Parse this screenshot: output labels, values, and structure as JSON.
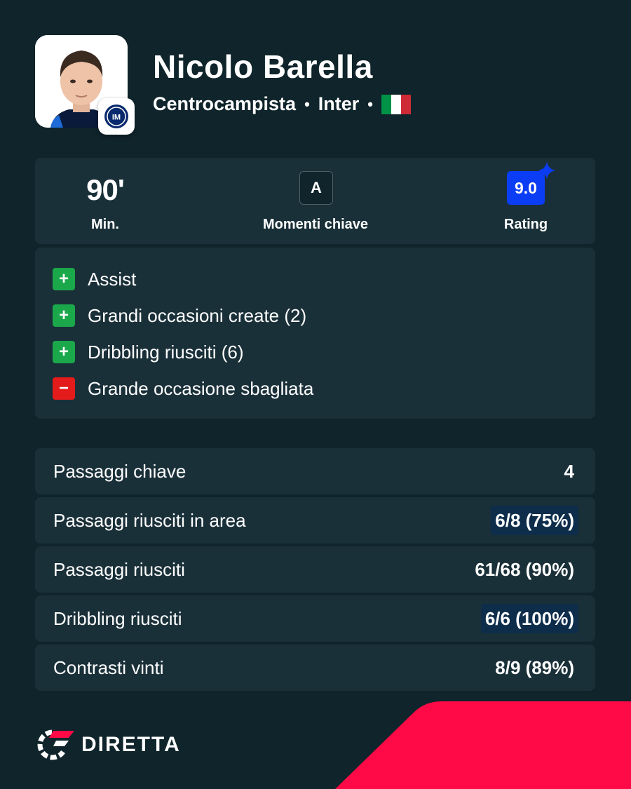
{
  "player": {
    "name": "Nicolo Barella",
    "position": "Centrocampista",
    "team": "Inter",
    "separator": "•",
    "flag_colors": [
      "#009246",
      "#ffffff",
      "#ce2b37"
    ]
  },
  "summary": {
    "minutes_value": "90'",
    "minutes_label": "Min.",
    "key_moments_icon_letter": "A",
    "key_moments_label": "Momenti chiave",
    "rating_value": "9.0",
    "rating_label": "Rating"
  },
  "events": [
    {
      "type": "plus",
      "sign": "+",
      "text": "Assist"
    },
    {
      "type": "plus",
      "sign": "+",
      "text": "Grandi occasioni create (2)"
    },
    {
      "type": "plus",
      "sign": "+",
      "text": "Dribbling riusciti (6)"
    },
    {
      "type": "minus",
      "sign": "−",
      "text": "Grande occasione sbagliata"
    }
  ],
  "stats": [
    {
      "label": "Passaggi chiave",
      "value": "4",
      "highlighted": false
    },
    {
      "label": "Passaggi riusciti in area",
      "value": "6/8 (75%)",
      "highlighted": true
    },
    {
      "label": "Passaggi riusciti",
      "value": "61/68 (90%)",
      "highlighted": false
    },
    {
      "label": "Dribbling riusciti",
      "value": "6/6 (100%)",
      "highlighted": true
    },
    {
      "label": "Contrasti vinti",
      "value": "8/9 (89%)",
      "highlighted": false
    }
  ],
  "brand": {
    "name": "DIRETTA"
  },
  "colors": {
    "background": "#0f242b",
    "card": "#1a3039",
    "rating": "#0b3df5",
    "positive": "#1aa84a",
    "negative": "#e31b1b",
    "accent": "#ff0a46"
  },
  "icons": {
    "club_badge": "inter-crest-icon",
    "key_moments": "key-moments-icon",
    "rating_star": "sparkle-icon",
    "brand_logo": "diretta-logo-icon"
  }
}
